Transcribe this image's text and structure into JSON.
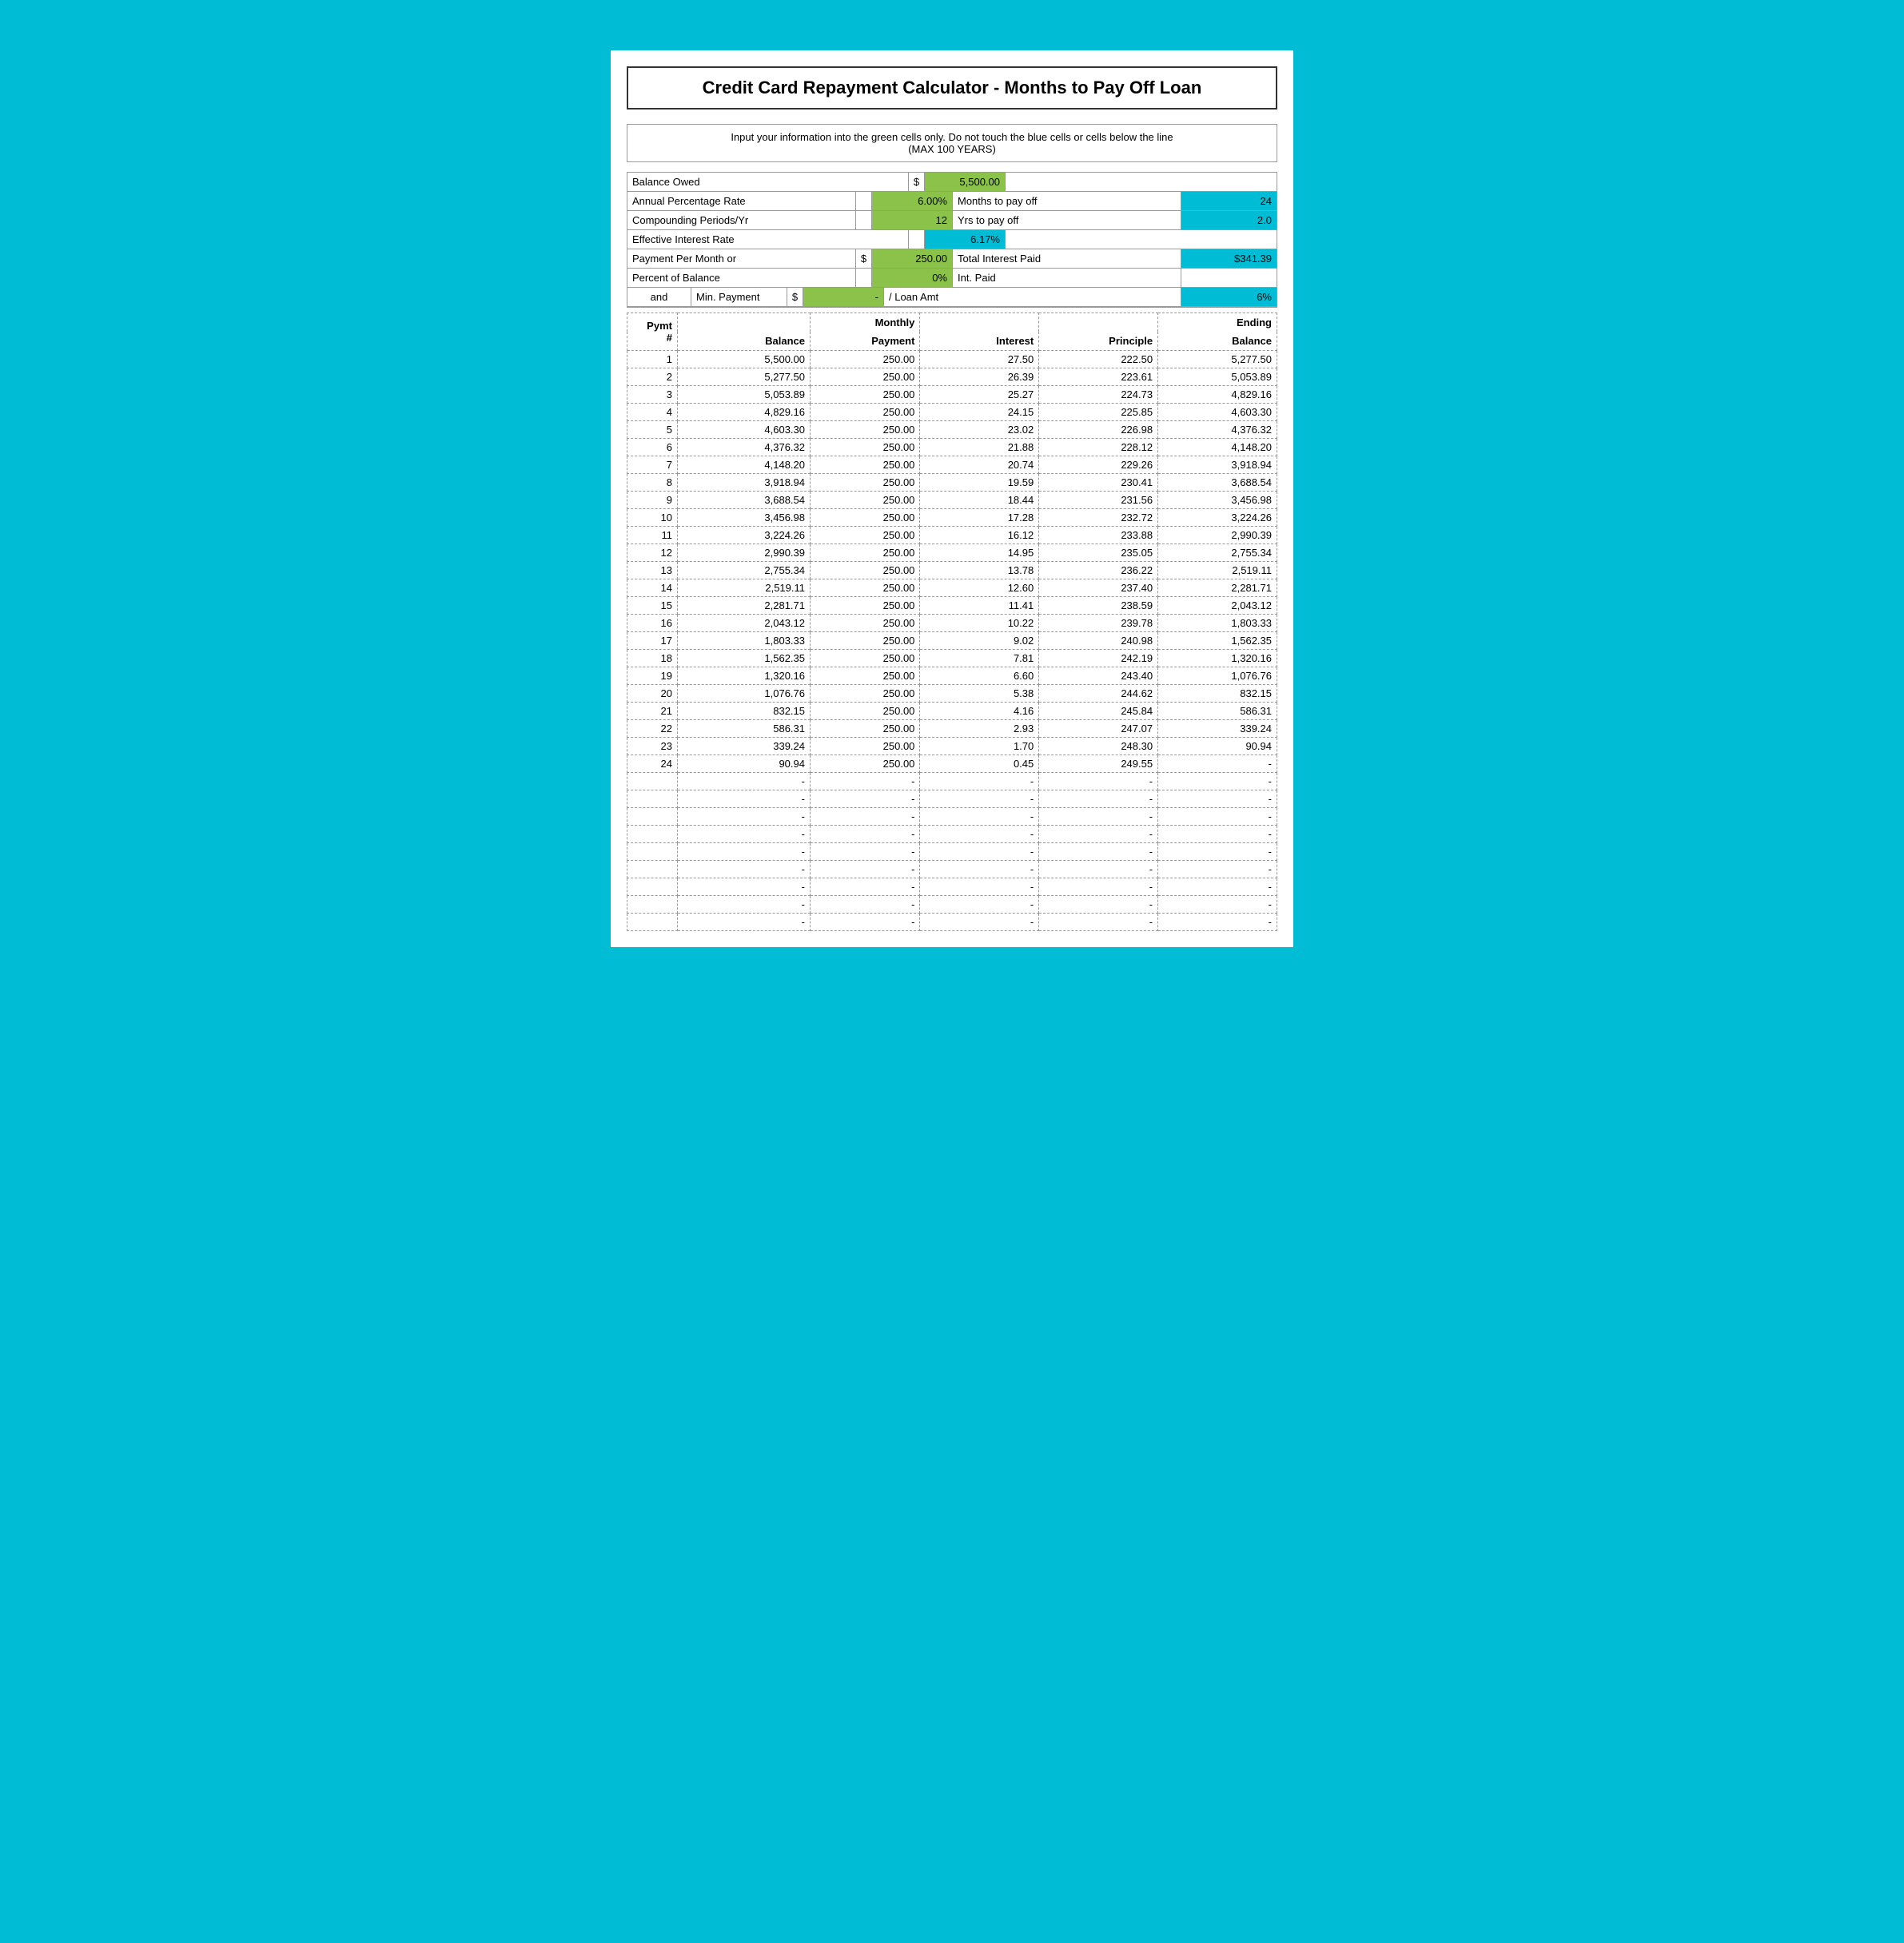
{
  "title": "Credit Card Repayment Calculator - Months to Pay Off Loan",
  "instruction_line1": "Input your information into the green cells only.  Do not touch the blue cells or cells below the line",
  "instruction_line2": "(MAX 100 YEARS)",
  "inputs": {
    "balance_owed_label": "Balance Owed",
    "balance_owed_dollar": "$",
    "balance_owed_value": "5,500.00",
    "apr_label": "Annual Percentage Rate",
    "apr_value": "6.00%",
    "apr_right_label": "Months to pay off",
    "apr_right_value": "24",
    "compounding_label": "Compounding Periods/Yr",
    "compounding_value": "12",
    "yrs_label": "Yrs to pay off",
    "yrs_value": "2.0",
    "effective_label": "Effective Interest Rate",
    "effective_value": "6.17%",
    "payment_label": "Payment Per Month or",
    "payment_dollar": "$",
    "payment_value": "250.00",
    "total_interest_label": "Total Interest Paid",
    "total_interest_value": "$341.39",
    "percent_label": "Percent of Balance",
    "percent_value": "0%",
    "int_paid_label": "Int. Paid",
    "and_label": "and",
    "min_payment_label": "Min. Payment",
    "min_dollar": "$",
    "min_value": "-",
    "loan_amt_label": "/ Loan Amt",
    "loan_amt_value": "6%"
  },
  "table": {
    "headers": [
      "Pymt #",
      "Balance",
      "Monthly Payment",
      "Interest",
      "Principle",
      "Ending Balance"
    ],
    "rows": [
      {
        "num": "1",
        "balance": "5,500.00",
        "payment": "250.00",
        "interest": "27.50",
        "principle": "222.50",
        "ending": "5,277.50"
      },
      {
        "num": "2",
        "balance": "5,277.50",
        "payment": "250.00",
        "interest": "26.39",
        "principle": "223.61",
        "ending": "5,053.89"
      },
      {
        "num": "3",
        "balance": "5,053.89",
        "payment": "250.00",
        "interest": "25.27",
        "principle": "224.73",
        "ending": "4,829.16"
      },
      {
        "num": "4",
        "balance": "4,829.16",
        "payment": "250.00",
        "interest": "24.15",
        "principle": "225.85",
        "ending": "4,603.30"
      },
      {
        "num": "5",
        "balance": "4,603.30",
        "payment": "250.00",
        "interest": "23.02",
        "principle": "226.98",
        "ending": "4,376.32"
      },
      {
        "num": "6",
        "balance": "4,376.32",
        "payment": "250.00",
        "interest": "21.88",
        "principle": "228.12",
        "ending": "4,148.20"
      },
      {
        "num": "7",
        "balance": "4,148.20",
        "payment": "250.00",
        "interest": "20.74",
        "principle": "229.26",
        "ending": "3,918.94"
      },
      {
        "num": "8",
        "balance": "3,918.94",
        "payment": "250.00",
        "interest": "19.59",
        "principle": "230.41",
        "ending": "3,688.54"
      },
      {
        "num": "9",
        "balance": "3,688.54",
        "payment": "250.00",
        "interest": "18.44",
        "principle": "231.56",
        "ending": "3,456.98"
      },
      {
        "num": "10",
        "balance": "3,456.98",
        "payment": "250.00",
        "interest": "17.28",
        "principle": "232.72",
        "ending": "3,224.26"
      },
      {
        "num": "11",
        "balance": "3,224.26",
        "payment": "250.00",
        "interest": "16.12",
        "principle": "233.88",
        "ending": "2,990.39"
      },
      {
        "num": "12",
        "balance": "2,990.39",
        "payment": "250.00",
        "interest": "14.95",
        "principle": "235.05",
        "ending": "2,755.34"
      },
      {
        "num": "13",
        "balance": "2,755.34",
        "payment": "250.00",
        "interest": "13.78",
        "principle": "236.22",
        "ending": "2,519.11"
      },
      {
        "num": "14",
        "balance": "2,519.11",
        "payment": "250.00",
        "interest": "12.60",
        "principle": "237.40",
        "ending": "2,281.71"
      },
      {
        "num": "15",
        "balance": "2,281.71",
        "payment": "250.00",
        "interest": "11.41",
        "principle": "238.59",
        "ending": "2,043.12"
      },
      {
        "num": "16",
        "balance": "2,043.12",
        "payment": "250.00",
        "interest": "10.22",
        "principle": "239.78",
        "ending": "1,803.33"
      },
      {
        "num": "17",
        "balance": "1,803.33",
        "payment": "250.00",
        "interest": "9.02",
        "principle": "240.98",
        "ending": "1,562.35"
      },
      {
        "num": "18",
        "balance": "1,562.35",
        "payment": "250.00",
        "interest": "7.81",
        "principle": "242.19",
        "ending": "1,320.16"
      },
      {
        "num": "19",
        "balance": "1,320.16",
        "payment": "250.00",
        "interest": "6.60",
        "principle": "243.40",
        "ending": "1,076.76"
      },
      {
        "num": "20",
        "balance": "1,076.76",
        "payment": "250.00",
        "interest": "5.38",
        "principle": "244.62",
        "ending": "832.15"
      },
      {
        "num": "21",
        "balance": "832.15",
        "payment": "250.00",
        "interest": "4.16",
        "principle": "245.84",
        "ending": "586.31"
      },
      {
        "num": "22",
        "balance": "586.31",
        "payment": "250.00",
        "interest": "2.93",
        "principle": "247.07",
        "ending": "339.24"
      },
      {
        "num": "23",
        "balance": "339.24",
        "payment": "250.00",
        "interest": "1.70",
        "principle": "248.30",
        "ending": "90.94"
      },
      {
        "num": "24",
        "balance": "90.94",
        "payment": "250.00",
        "interest": "0.45",
        "principle": "249.55",
        "ending": "-"
      },
      {
        "num": "",
        "balance": "-",
        "payment": "-",
        "interest": "-",
        "principle": "-",
        "ending": "-"
      },
      {
        "num": "",
        "balance": "-",
        "payment": "-",
        "interest": "-",
        "principle": "-",
        "ending": "-"
      },
      {
        "num": "",
        "balance": "-",
        "payment": "-",
        "interest": "-",
        "principle": "-",
        "ending": "-"
      },
      {
        "num": "",
        "balance": "-",
        "payment": "-",
        "interest": "-",
        "principle": "-",
        "ending": "-"
      },
      {
        "num": "",
        "balance": "-",
        "payment": "-",
        "interest": "-",
        "principle": "-",
        "ending": "-"
      },
      {
        "num": "",
        "balance": "-",
        "payment": "-",
        "interest": "-",
        "principle": "-",
        "ending": "-"
      },
      {
        "num": "",
        "balance": "-",
        "payment": "-",
        "interest": "-",
        "principle": "-",
        "ending": "-"
      },
      {
        "num": "",
        "balance": "-",
        "payment": "-",
        "interest": "-",
        "principle": "-",
        "ending": "-"
      },
      {
        "num": "",
        "balance": "-",
        "payment": "-",
        "interest": "-",
        "principle": "-",
        "ending": "-"
      }
    ]
  }
}
